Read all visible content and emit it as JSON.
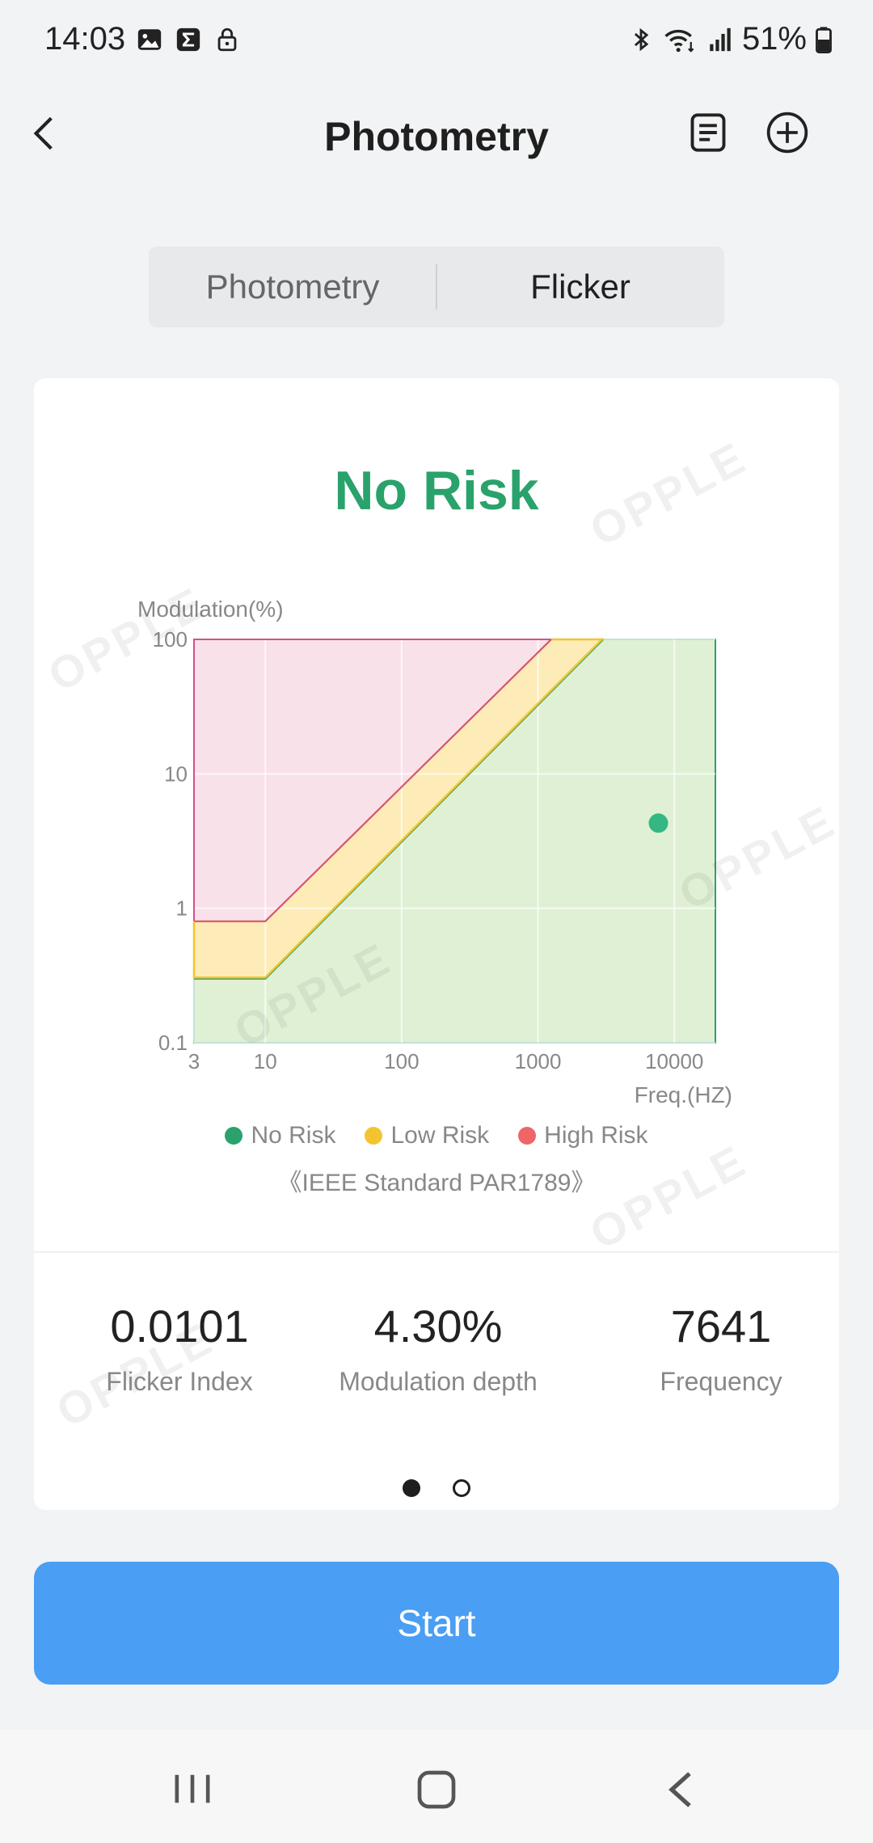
{
  "status_bar": {
    "time": "14:03",
    "battery": "51%",
    "left_icons": [
      "image-icon",
      "sigma-icon",
      "lock-icon"
    ],
    "right_icons": [
      "bluetooth-icon",
      "wifi-icon",
      "signal-icon",
      "battery-icon"
    ]
  },
  "header": {
    "title": "Photometry",
    "icons": [
      "back-icon",
      "report-icon",
      "add-circle-icon"
    ]
  },
  "tabs": [
    {
      "label": "Photometry",
      "active": false
    },
    {
      "label": "Flicker",
      "active": true
    }
  ],
  "card": {
    "risk_status": "No Risk",
    "watermark": "OPPLE",
    "standard": "《IEEE Standard PAR1789》",
    "legend": [
      {
        "label": "No Risk",
        "color": "#2aa26b"
      },
      {
        "label": "Low Risk",
        "color": "#f4c430"
      },
      {
        "label": "High Risk",
        "color": "#ee6666"
      }
    ]
  },
  "chart_data": {
    "type": "area",
    "xlabel": "Freq.(HZ)",
    "ylabel": "Modulation(%)",
    "x_scale": "log",
    "y_scale": "log",
    "xlim": [
      3,
      20000
    ],
    "ylim": [
      0.1,
      100
    ],
    "x_ticks": [
      3,
      10,
      100,
      1000,
      10000
    ],
    "x_tick_labels": [
      "3",
      "10",
      "100",
      "1000",
      "10000"
    ],
    "y_ticks": [
      0.1,
      1,
      10,
      100
    ],
    "y_tick_labels": [
      "0.1",
      "1",
      "10",
      "100"
    ],
    "grid": true,
    "series": [
      {
        "name": "High Risk",
        "color": "#ee6666",
        "fill": "#f9e1ea",
        "boundary": [
          [
            3,
            0.8
          ],
          [
            10,
            0.8
          ],
          [
            1250,
            100
          ]
        ]
      },
      {
        "name": "Low Risk",
        "color": "#f4c430",
        "fill": "#fdecb8",
        "boundary": [
          [
            3,
            0.3
          ],
          [
            10,
            0.3
          ],
          [
            3000,
            100
          ]
        ]
      },
      {
        "name": "No Risk",
        "color": "#2aa26b",
        "fill": "#e0f0d4",
        "boundary": [
          [
            3,
            0.1
          ],
          [
            20000,
            0.1
          ]
        ]
      }
    ],
    "measurement": {
      "x": 7641,
      "y": 4.3,
      "color": "#33b883"
    }
  },
  "metrics": [
    {
      "value": "0.0101",
      "label": "Flicker Index"
    },
    {
      "value": "4.30%",
      "label": "Modulation depth"
    },
    {
      "value": "7641",
      "label": "Frequency"
    }
  ],
  "pager": {
    "pages": 2,
    "active": 0
  },
  "start_button": {
    "label": "Start"
  },
  "nav_bar": {
    "icons": [
      "recent-apps-icon",
      "home-icon",
      "back-nav-icon"
    ]
  }
}
